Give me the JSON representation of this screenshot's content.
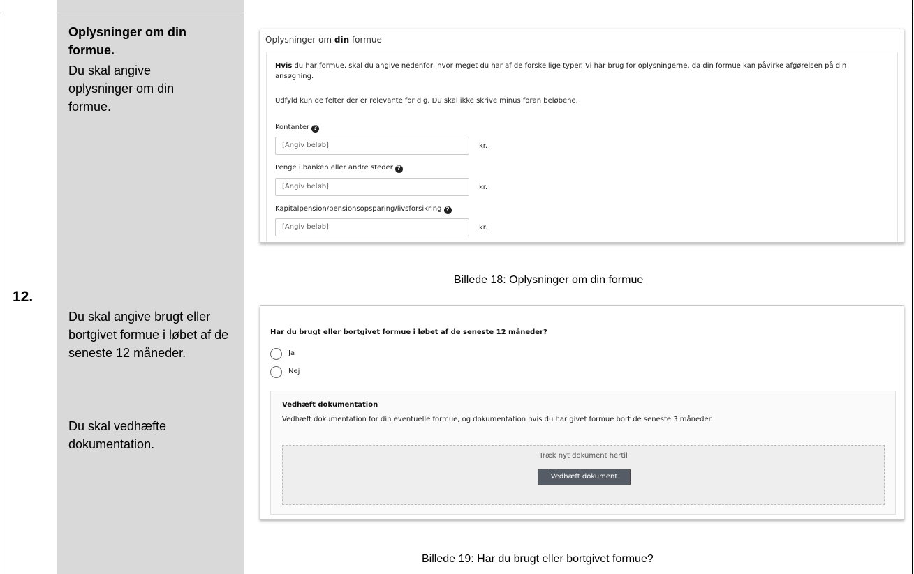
{
  "step_number": "12.",
  "left": {
    "heading": "Oplysninger om din formue.",
    "text1": "Du skal angive oplysninger om din formue.",
    "text2": "Du skal angive brugt eller bortgivet formue i løbet af de seneste 12 måneder.",
    "text3": "Du skal vedhæfte dokumentation."
  },
  "panel1": {
    "title_pre": "Oplysninger om ",
    "title_bold": "din",
    "title_post": " formue",
    "intro_bold": "Hvis",
    "intro_rest": " du har formue, skal du angive nedenfor, hvor meget du har af de forskellige typer. Vi har brug for oplysningerne, da din formue kan påvirke afgørelsen på din ansøgning.",
    "intro2": "Udfyld kun de felter der er relevante for dig. Du skal ikke skrive minus foran beløbene.",
    "help_glyph": "?",
    "fields": [
      {
        "label": "Kontanter",
        "placeholder": "[Angiv beløb]",
        "unit": "kr."
      },
      {
        "label": "Penge i banken eller andre steder",
        "placeholder": "[Angiv beløb]",
        "unit": "kr."
      },
      {
        "label": "Kapitalpension/pensionsopsparing/livsforsikring",
        "placeholder": "[Angiv beløb]",
        "unit": "kr."
      }
    ]
  },
  "caption1": "Billede 18: Oplysninger om din formue",
  "panel2": {
    "question": "Har du brugt eller bortgivet formue i løbet af de seneste 12 måneder?",
    "options": [
      "Ja",
      "Nej"
    ],
    "doc_title": "Vedhæft dokumentation",
    "doc_desc": "Vedhæft dokumentation for din eventuelle formue, og dokumentation hvis du har givet formue bort de seneste 3 måneder.",
    "drop_text": "Træk nyt dokument hertil",
    "attach_button": "Vedhæft dokument"
  },
  "caption2": "Billede 19: Har du brugt eller bortgivet formue?"
}
